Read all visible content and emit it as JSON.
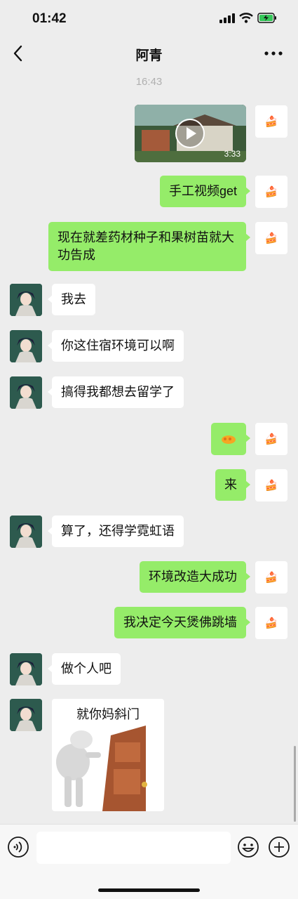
{
  "status_bar": {
    "time": "01:42"
  },
  "nav": {
    "title": "阿青"
  },
  "chat": {
    "timestamp": "16:43",
    "video_duration": "3:33",
    "messages_me": [
      "手工视频get",
      "现在就差药材种子和果树苗就大功告成",
      "来",
      "环境改造大成功",
      "我决定今天煲佛跳墙"
    ],
    "messages_peer": [
      "我去",
      "你这住宿环境可以啊",
      "搞得我都想去留学了",
      "算了，还得学霓虹语",
      "做个人吧"
    ],
    "sticker_caption": "就你妈斜门"
  },
  "icons": {
    "back": "chevron-left-icon",
    "more": "more-icon",
    "voice": "voice-icon",
    "emoji": "emoji-icon",
    "plus": "plus-icon",
    "my_avatar": "cake-icon"
  },
  "colors": {
    "my_bubble": "#95ec69",
    "peer_bubble": "#ffffff",
    "background": "#ededed"
  }
}
